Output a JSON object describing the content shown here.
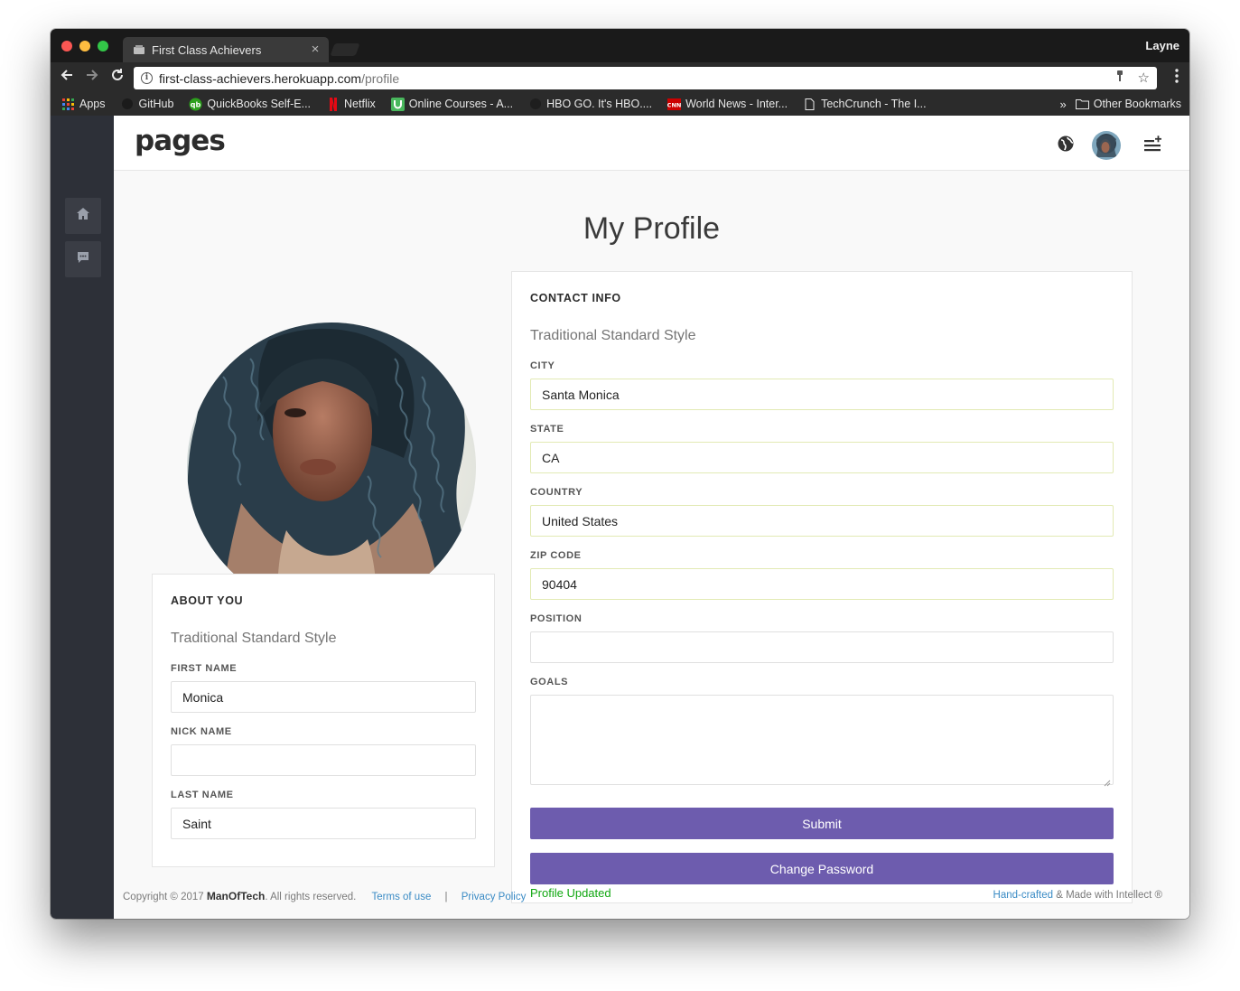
{
  "browser": {
    "tab_title": "First Class Achievers",
    "profile_name": "Layne",
    "url_host": "first-class-achievers.herokuapp.com",
    "url_path": "/profile"
  },
  "bookmarks": {
    "items": [
      {
        "label": "Apps",
        "icon": "apps-grid-icon"
      },
      {
        "label": "GitHub",
        "icon": "github-icon"
      },
      {
        "label": "QuickBooks Self-E...",
        "icon": "quickbooks-icon"
      },
      {
        "label": "Netflix",
        "icon": "netflix-icon"
      },
      {
        "label": "Online Courses - A...",
        "icon": "udemy-icon"
      },
      {
        "label": "HBO GO. It's HBO....",
        "icon": "hbo-icon"
      },
      {
        "label": "World News - Inter...",
        "icon": "cnn-icon"
      },
      {
        "label": "TechCrunch - The I...",
        "icon": "page-icon"
      }
    ],
    "other_label": "Other Bookmarks"
  },
  "app": {
    "logo": "pages"
  },
  "profile": {
    "page_title": "My Profile",
    "about": {
      "title": "ABOUT YOU",
      "subtitle": "Traditional Standard Style",
      "first_name_label": "FIRST NAME",
      "first_name": "Monica",
      "nick_name_label": "NICK NAME",
      "nick_name": "",
      "last_name_label": "LAST NAME",
      "last_name": "Saint"
    },
    "contact": {
      "title": "CONTACT INFO",
      "subtitle": "Traditional Standard Style",
      "city_label": "CITY",
      "city": "Santa Monica",
      "state_label": "STATE",
      "state": "CA",
      "country_label": "COUNTRY",
      "country": "United States",
      "zip_label": "ZIP CODE",
      "zip": "90404",
      "position_label": "POSITION",
      "position": "",
      "goals_label": "GOALS",
      "goals": ""
    },
    "submit_label": "Submit",
    "change_password_label": "Change Password",
    "status_message": "Profile Updated"
  },
  "footer": {
    "copyright_prefix": "Copyright © 2017",
    "brand": "ManOfTech",
    "rights": ". All rights reserved.",
    "terms": "Terms of use",
    "separator": "|",
    "privacy": "Privacy Policy",
    "handcrafted": "Hand-crafted",
    "made_with": " & Made with Intellect ®"
  },
  "colors": {
    "primary_button": "#6d5cae",
    "sidebar": "#2d3038",
    "status_success": "#10a710",
    "link": "#3a8bc5"
  }
}
